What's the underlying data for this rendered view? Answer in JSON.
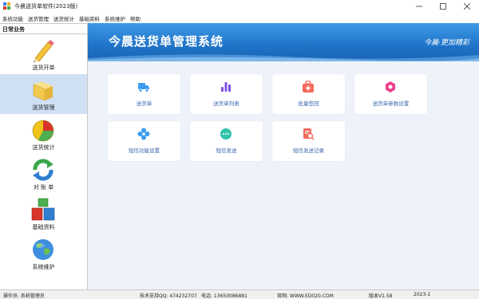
{
  "window": {
    "title": "今晨送货单软件(2023版)"
  },
  "menu": [
    "系统功能",
    "送货管理",
    "送货统计",
    "基础资料",
    "系统维护",
    "帮助"
  ],
  "sidebar": {
    "header": "日常业务",
    "items": [
      {
        "label": "送货开单",
        "icon": "pencil-icon"
      },
      {
        "label": "送货管理",
        "icon": "folder-icon"
      },
      {
        "label": "送货统计",
        "icon": "pie-chart-icon"
      },
      {
        "label": "对 账 单",
        "icon": "refresh-icon"
      },
      {
        "label": "基础资料",
        "icon": "blocks-icon"
      },
      {
        "label": "系统维护",
        "icon": "globe-icon"
      }
    ]
  },
  "banner": {
    "title": "今晨送货单管理系统",
    "slogan": "今晨·更加精彩"
  },
  "tiles": [
    {
      "label": "送货单",
      "icon": "truck-icon",
      "color": "#3b9bf0"
    },
    {
      "label": "送货单列表",
      "icon": "bar-chart-icon",
      "color": "#7b4fe0"
    },
    {
      "label": "批量签回",
      "icon": "medical-box-icon",
      "color": "#f26b5b"
    },
    {
      "label": "送货单参数设置",
      "icon": "hexagon-settings-icon",
      "color": "#ef3e8a"
    },
    {
      "label": "短信功能设置",
      "icon": "flower-settings-icon",
      "color": "#3b9bf0"
    },
    {
      "label": "短信发送",
      "icon": "chat-bubble-icon",
      "color": "#31c3a8"
    },
    {
      "label": "短信发送记录",
      "icon": "document-search-icon",
      "color": "#f26b5b"
    }
  ],
  "status": {
    "operator": "操作员: 系统管理员",
    "support": "技术支持QQ: 474232707",
    "phone": "电话: 13650086881",
    "website": "官网: WWW.ED020.COM",
    "version": "版本V1.58",
    "date": "2023-1"
  }
}
